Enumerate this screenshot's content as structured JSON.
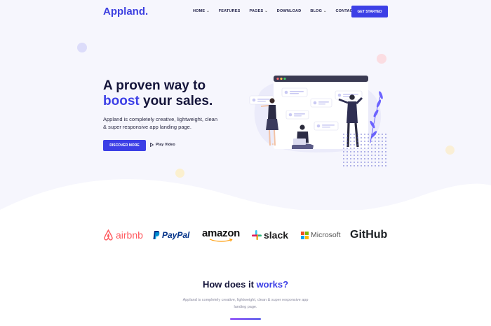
{
  "header": {
    "logo": "Appland.",
    "nav": [
      {
        "label": "HOME",
        "dropdown": true
      },
      {
        "label": "FEATURES",
        "dropdown": false
      },
      {
        "label": "PAGES",
        "dropdown": true
      },
      {
        "label": "DOWNLOAD",
        "dropdown": false
      },
      {
        "label": "BLOG",
        "dropdown": true
      },
      {
        "label": "CONTACT",
        "dropdown": false
      }
    ],
    "cta": "GET STARTED"
  },
  "hero": {
    "title_line1": "A proven way to",
    "title_accent": "boost",
    "title_rest": " your sales.",
    "subtitle": "Appland is completely creative, lightweight, clean & super responsive app landing page.",
    "primary_button": "DISCOVER MORE",
    "video_link": "Play Video"
  },
  "brands": [
    "airbnb",
    "PayPal",
    "amazon",
    "slack",
    "Microsoft",
    "GitHub"
  ],
  "how": {
    "title_start": "How does it ",
    "title_accent": "works?",
    "subtitle": "Appland is completely creative, lightweight, clean & super responsive app landing page."
  },
  "colors": {
    "accent": "#3c3fe6",
    "airbnb": "#ff5a5f",
    "paypal_dark": "#003087",
    "paypal_light": "#009cde",
    "amazon_arrow": "#ff9900"
  }
}
